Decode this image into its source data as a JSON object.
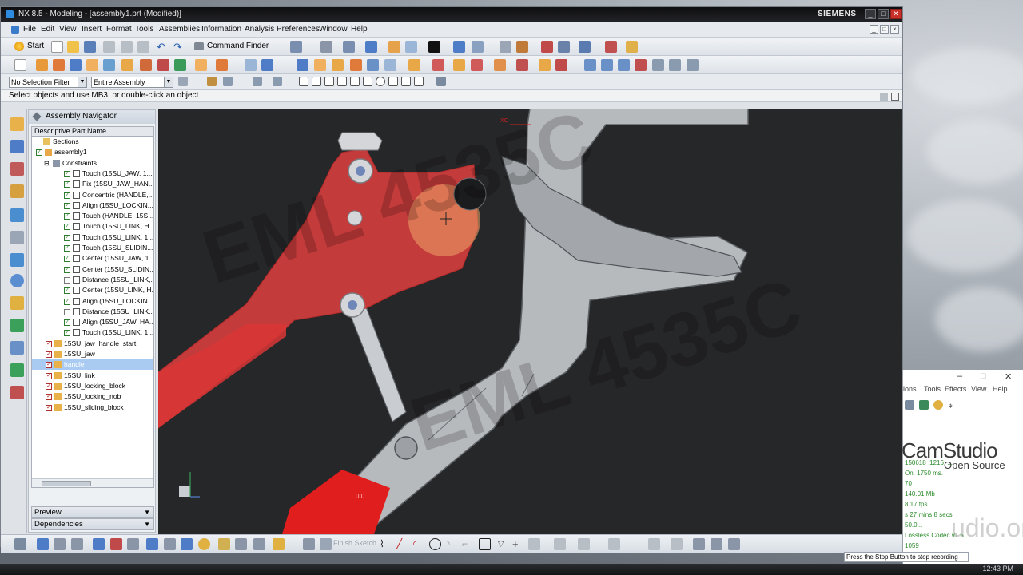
{
  "window": {
    "title": "NX 8.5 - Modeling - [assembly1.prt (Modified)]",
    "brand": "SIEMENS"
  },
  "menu": [
    "File",
    "Edit",
    "View",
    "Insert",
    "Format",
    "Tools",
    "Assemblies",
    "Information",
    "Analysis",
    "Preferences",
    "Window",
    "Help"
  ],
  "toolbar": {
    "start_label": "Start",
    "command_finder_label": "Command Finder"
  },
  "selection_bar": {
    "filter": "No Selection Filter",
    "scope": "Entire Assembly"
  },
  "cue_line": "Select objects and use MB3, or double-click an object",
  "navigator": {
    "title": "Assembly Navigator",
    "column_header": "Descriptive Part Name",
    "items": [
      {
        "label": "Sections",
        "indent": 0
      },
      {
        "label": "assembly1",
        "indent": 0
      },
      {
        "label": "Constraints",
        "indent": 1
      },
      {
        "label": "Touch (15SU_JAW, 1...",
        "indent": 2
      },
      {
        "label": "Fix (15SU_JAW_HAN...",
        "indent": 2
      },
      {
        "label": "Concentric (HANDLE,...",
        "indent": 2
      },
      {
        "label": "Align (15SU_LOCKIN...",
        "indent": 2
      },
      {
        "label": "Touch (HANDLE, 15S...",
        "indent": 2
      },
      {
        "label": "Touch (15SU_LINK, H...",
        "indent": 2
      },
      {
        "label": "Touch (15SU_LINK, 1...",
        "indent": 2
      },
      {
        "label": "Touch (15SU_SLIDIN...",
        "indent": 2
      },
      {
        "label": "Center (15SU_JAW, 1...",
        "indent": 2
      },
      {
        "label": "Center (15SU_SLIDIN...",
        "indent": 2
      },
      {
        "label": "Distance (15SU_LINK,...",
        "indent": 2
      },
      {
        "label": "Center (15SU_LINK, H...",
        "indent": 2
      },
      {
        "label": "Align (15SU_LOCKIN...",
        "indent": 2
      },
      {
        "label": "Distance (15SU_LINK...",
        "indent": 2
      },
      {
        "label": "Align (15SU_JAW, HA...",
        "indent": 2
      },
      {
        "label": "Touch (15SU_LINK, 1...",
        "indent": 2
      },
      {
        "label": "15SU_jaw_handle_start",
        "indent": 1
      },
      {
        "label": "15SU_jaw",
        "indent": 1
      },
      {
        "label": "handle",
        "indent": 1
      },
      {
        "label": "15SU_link",
        "indent": 1
      },
      {
        "label": "15SU_locking_block",
        "indent": 1
      },
      {
        "label": "15SU_locking_nob",
        "indent": 1
      },
      {
        "label": "15SU_sliding_block",
        "indent": 1
      }
    ],
    "preview_label": "Preview",
    "dependencies_label": "Dependencies"
  },
  "graphics": {
    "watermark": "EML 4535C",
    "axis_label": "XC",
    "dim_label": "0.0"
  },
  "bottom_toolbar": {
    "finish_sketch": "Finish Sketch"
  },
  "camstudio": {
    "menu": [
      "ions",
      "Tools",
      "Effects",
      "View",
      "Help"
    ],
    "logo_main": "CamStudio",
    "logo_sub": "Open Source",
    "stats": [
      "150618_1216_...",
      "On, 1750 ms.",
      "70",
      "140.01 Mb",
      "8.17 fps",
      "s 27 mins 8 secs",
      "50.0...",
      "Lossless Codec v1.5",
      "1059"
    ],
    "watermark": "udio.org",
    "tooltip": "Press the Stop Button to stop recording"
  },
  "taskbar": {
    "clock": "12:43 PM"
  },
  "colors": {
    "handle_red": "#e8403f",
    "part_gray": "#b9bcbf",
    "graphics_bg": "#262729"
  }
}
